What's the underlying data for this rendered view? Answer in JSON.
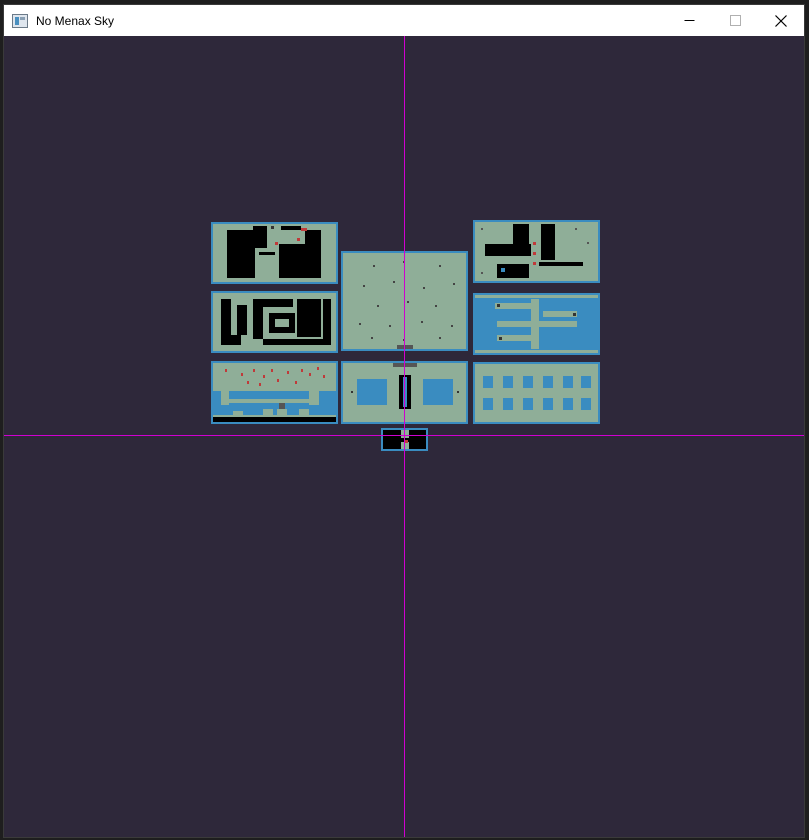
{
  "window": {
    "title": "No Menax Sky",
    "controls": {
      "minimize_icon": "minimize-icon",
      "maximize_icon": "maximize-icon",
      "close_icon": "close-icon"
    }
  },
  "canvas": {
    "background_color": "#2e283a",
    "axis_color": "#d000d0",
    "room_border_color": "#3a8cc0",
    "room_floor_color": "#8fae98",
    "room_wall_color": "#000000",
    "room_water_color": "#3a8cc0",
    "hazard_color": "#c03a3a"
  },
  "rooms": [
    {
      "id": "room-top-left",
      "kind": "dark-corridors"
    },
    {
      "id": "room-top-center",
      "kind": "open-floor"
    },
    {
      "id": "room-top-right",
      "kind": "mixed"
    },
    {
      "id": "room-mid-left",
      "kind": "maze"
    },
    {
      "id": "room-mid-right",
      "kind": "platforms"
    },
    {
      "id": "room-bottom-left",
      "kind": "water-hazards"
    },
    {
      "id": "room-bottom-center",
      "kind": "twin-pools"
    },
    {
      "id": "room-bottom-right",
      "kind": "pillar-grid"
    },
    {
      "id": "room-origin",
      "kind": "spawn"
    }
  ]
}
